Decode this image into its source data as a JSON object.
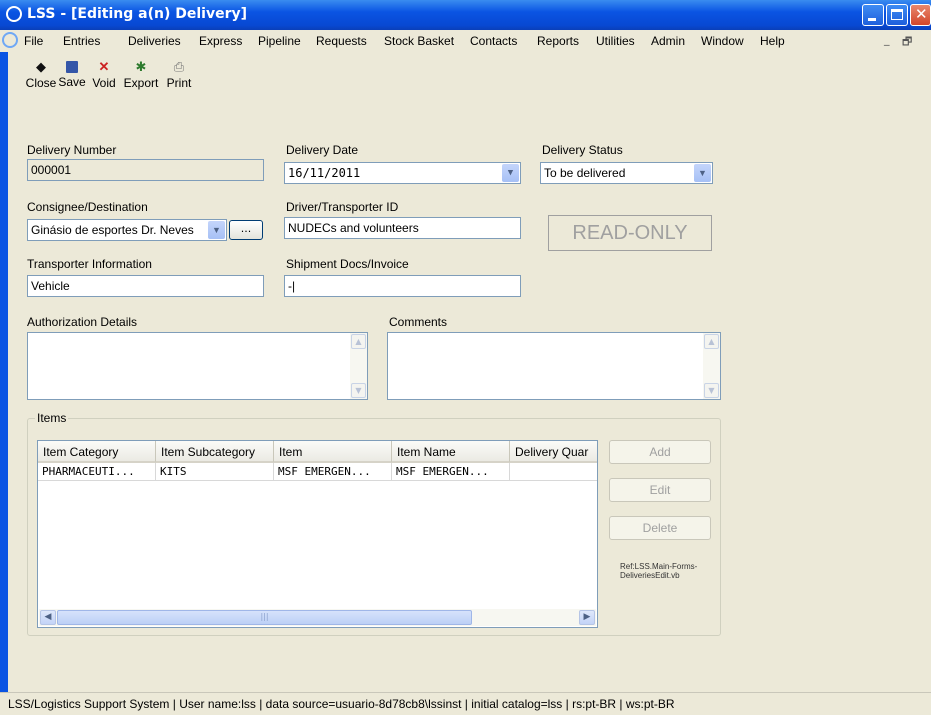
{
  "window": {
    "title": "LSS - [Editing a(n) Delivery]",
    "accent_color": "#0a54e3"
  },
  "menu": [
    "File",
    "Entries",
    "Deliveries",
    "Express",
    "Pipeline",
    "Requests",
    "Stock Basket",
    "Contacts",
    "Reports",
    "Utilities",
    "Admin",
    "Window",
    "Help"
  ],
  "toolbar": {
    "close": "Close",
    "save": "Save",
    "void": "Void",
    "export": "Export",
    "print": "Print"
  },
  "form": {
    "delivery_number_label": "Delivery Number",
    "delivery_number": "000001",
    "delivery_date_label": "Delivery Date",
    "delivery_date": "16/11/2011",
    "delivery_status_label": "Delivery Status",
    "delivery_status": "To be delivered",
    "consignee_label": "Consignee/Destination",
    "consignee": "Ginásio de esportes Dr. Neves",
    "browse_button": "...",
    "driver_label": "Driver/Transporter ID",
    "driver": "NUDECs and volunteers",
    "readonly_badge": "READ-ONLY",
    "transporter_info_label": "Transporter Information",
    "transporter_info": "Vehicle",
    "shipment_docs_label": "Shipment Docs/Invoice",
    "shipment_docs": "-|",
    "authorization_label": "Authorization Details",
    "authorization": "",
    "comments_label": "Comments",
    "comments": ""
  },
  "items": {
    "group_label": "Items",
    "columns": [
      "Item Category",
      "Item Subcategory",
      "Item",
      "Item Name",
      "Delivery Quar"
    ],
    "rows": [
      [
        "PHARMACEUTI...",
        "KITS",
        "MSF EMERGEN...",
        "MSF EMERGEN...",
        ""
      ]
    ],
    "add_button": "Add",
    "edit_button": "Edit",
    "delete_button": "Delete",
    "ref_text": "Ref:LSS.Main-Forms-DeliveriesEdit.vb"
  },
  "status_bar": "LSS/Logistics Support System | User name:lss | data source=usuario-8d78cb8\\lssinst | initial catalog=lss | rs:pt-BR | ws:pt-BR"
}
